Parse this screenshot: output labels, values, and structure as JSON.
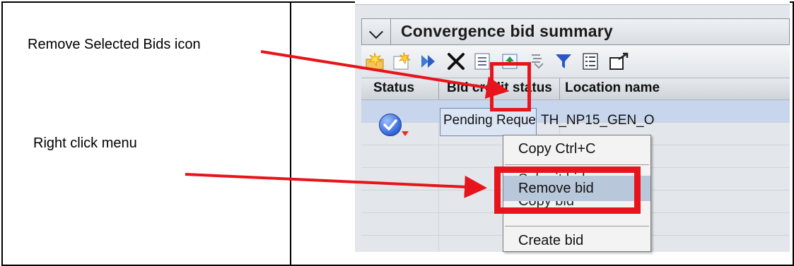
{
  "annotations": {
    "remove_icon_label": "Remove Selected Bids icon",
    "right_click_label": "Right click menu"
  },
  "panel": {
    "title": "Convergence bid summary"
  },
  "toolbar": {
    "icons": [
      "new-bid-icon",
      "new-bid-alt-icon",
      "submit-arrow-icon",
      "remove-selected-bids-icon",
      "copy-list-icon",
      "export-icon",
      "import-icon",
      "filter-icon",
      "checklist-icon",
      "popout-icon"
    ]
  },
  "grid": {
    "columns": [
      "Status",
      "Bid credit status",
      "Location name"
    ],
    "rows": [
      {
        "status_icon": "status-check-icon",
        "bid_credit_status": "Pending Request",
        "location_name": "TH_NP15_GEN_O"
      }
    ]
  },
  "context_menu": {
    "items": [
      "Copy Ctrl+C",
      "Submit bid",
      "Remove bid",
      "Copy bid",
      "Create bid"
    ]
  },
  "colors": {
    "annotation_red": "#e8141b",
    "selection_blue": "#c7d6ec",
    "check_blue": "#2f64d8"
  }
}
